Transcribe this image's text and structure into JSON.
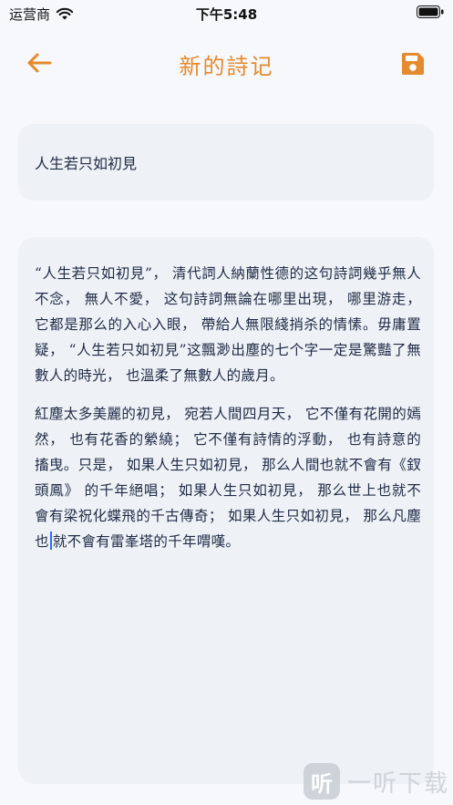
{
  "status_bar": {
    "carrier": "运营商",
    "time": "下午5:48"
  },
  "header": {
    "title": "新的詩记",
    "back_icon": "arrow-left-icon",
    "save_icon": "save-icon"
  },
  "colors": {
    "accent": "#e58a2e",
    "text": "#1f2a44",
    "card_bg": "#eef2f7",
    "page_bg": "#f6f8fb",
    "caret": "#2b6cff"
  },
  "editor": {
    "title_value": "人生若只如初見",
    "body": {
      "p1": "“人生若只如初見”， 清代詞人納蘭性德的这句詩詞幾乎無人不念， 無人不愛， 这句詩詞無論在哪里出現， 哪里游走， 它都是那么的入心入眼， 帶給人無限綫捎杀的情愫。毋庸置疑， “人生若只如初見”这飄渺出塵的七个字一定是驚豔了無數人的時光， 也溫柔了無數人的歲月。",
      "p2_before_caret": "紅塵太多美麗的初見， 宛若人間四月天， 它不僅有花開的嫣然， 也有花香的縈繞； 它不僅有詩情的浮動， 也有詩意的搐曳。只是， 如果人生只如初見， 那么人間也就不會有《釵頭鳳》 的千年絕唱； 如果人生只如初見， 那么世上也就不會有梁祝化蝶飛的千古傳奇； 如果人生只如初見， 那么凡塵也",
      "p2_after_caret": "就不會有雷峯塔的千年喟嘆。"
    }
  },
  "watermark": {
    "logo_char": "听",
    "text": "一听下载"
  }
}
